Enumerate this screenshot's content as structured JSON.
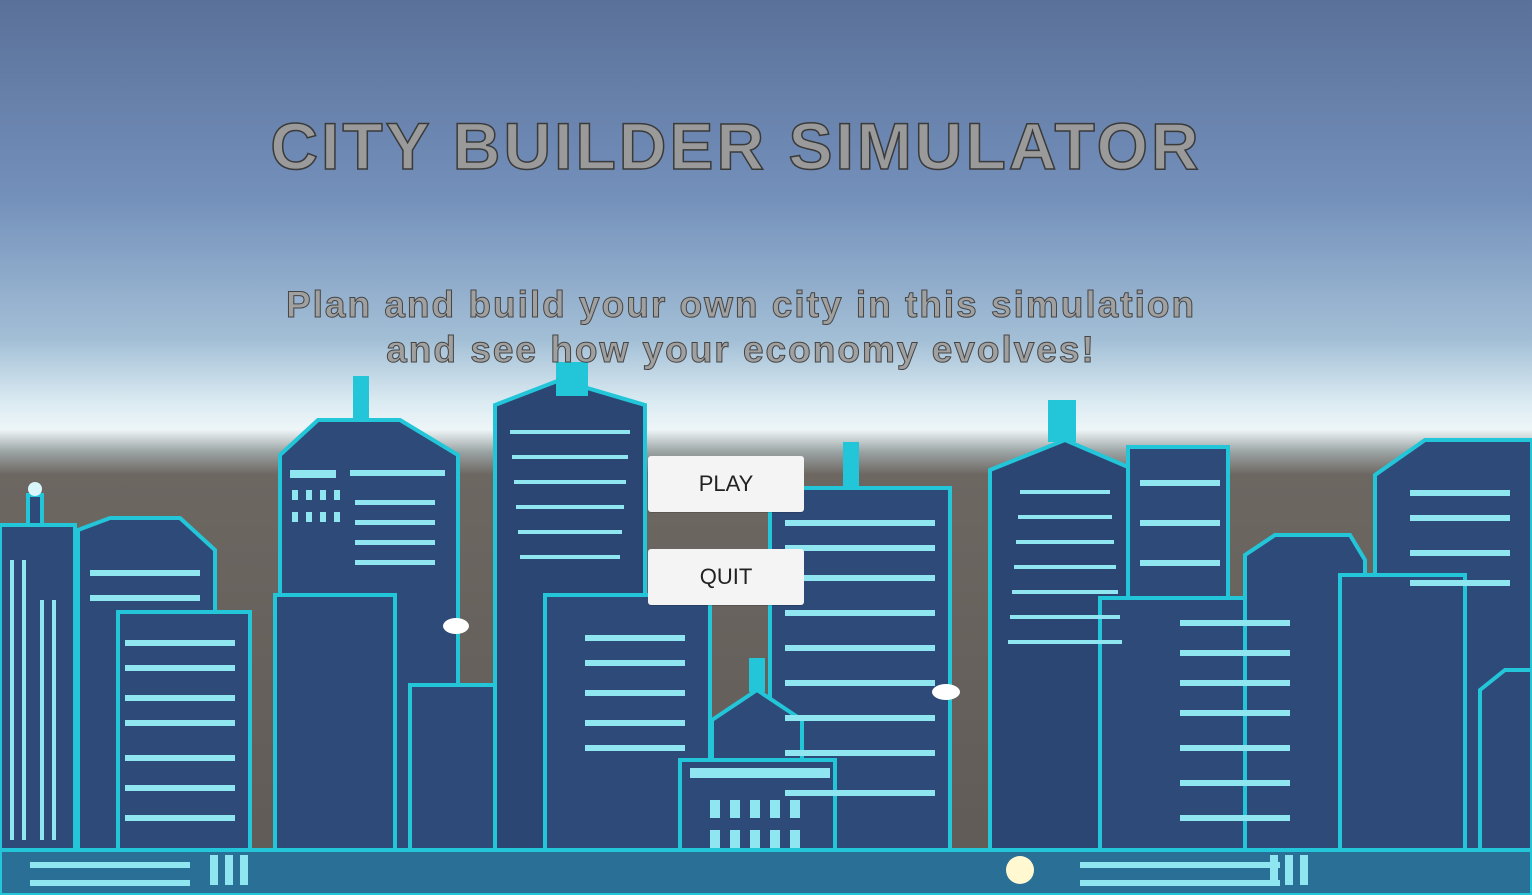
{
  "menu": {
    "title": "CITY BUILDER SIMULATOR",
    "subtitle_line1": "Plan and build your own city in this simulation",
    "subtitle_line2": "and see how your economy evolves!",
    "play_label": "PLAY",
    "quit_label": "QUIT"
  },
  "colors": {
    "sky_top": "#5a7199",
    "horizon_glow": "#e8f2f6",
    "ground": "#6a6460",
    "building_dark": "#2e4a78",
    "building_cyan": "#23c6d8",
    "window_light": "#bfeff5"
  }
}
